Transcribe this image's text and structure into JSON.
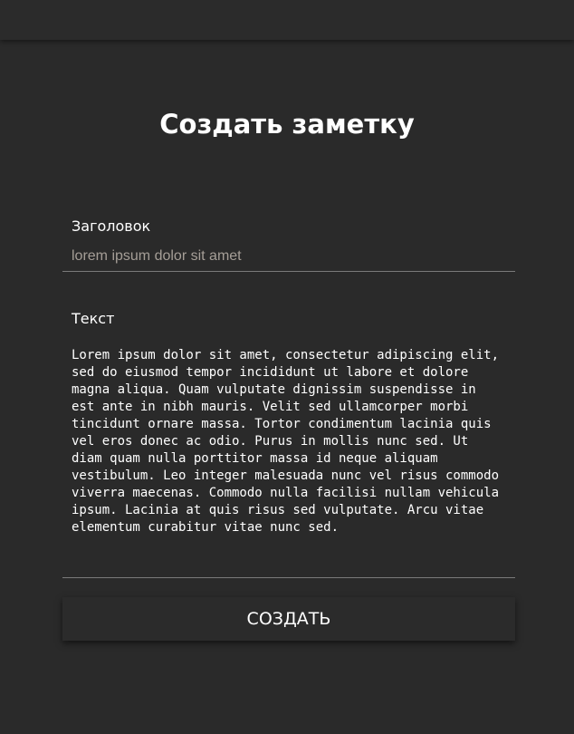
{
  "page": {
    "title": "Создать заметку"
  },
  "form": {
    "title_label": "Заголовок",
    "title_placeholder": "lorem ipsum dolor sit amet",
    "title_value": "",
    "text_label": "Текст",
    "text_value": "Lorem ipsum dolor sit amet, consectetur adipiscing elit, sed do eiusmod tempor incididunt ut labore et dolore magna aliqua. Quam vulputate dignissim suspendisse in est ante in nibh mauris. Velit sed ullamcorper morbi tincidunt ornare massa. Tortor condimentum lacinia quis vel eros donec ac odio. Purus in mollis nunc sed. Ut diam quam nulla porttitor massa id neque aliquam vestibulum. Leo integer malesuada nunc vel risus commodo viverra maecenas. Commodo nulla facilisi nullam vehicula ipsum. Lacinia at quis risus sed vulputate. Arcu vitae elementum curabitur vitae nunc sed.",
    "submit_label": "СОЗДАТЬ"
  },
  "colors": {
    "background": "#2a2a2a",
    "placeholder": "#a59e97",
    "underline": "#7a7a7a",
    "text": "#ffffff"
  }
}
